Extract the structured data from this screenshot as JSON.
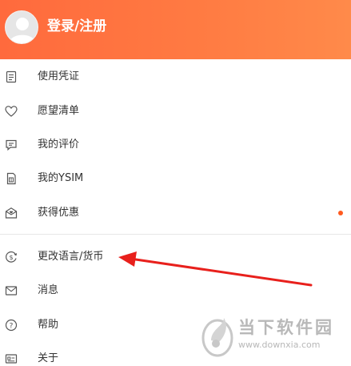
{
  "header": {
    "login_label": "登录/注册"
  },
  "menu": {
    "items": [
      {
        "label": "使用凭证",
        "icon": "voucher-icon"
      },
      {
        "label": "愿望清单",
        "icon": "heart-icon"
      },
      {
        "label": "我的评价",
        "icon": "comment-icon"
      },
      {
        "label": "我的YSIM",
        "icon": "sim-card-icon"
      },
      {
        "label": "获得优惠",
        "icon": "coupon-icon",
        "badge": "dot"
      },
      {
        "label": "更改语言/货币",
        "icon": "currency-icon"
      },
      {
        "label": "消息",
        "icon": "mail-icon"
      },
      {
        "label": "帮助",
        "icon": "help-icon"
      },
      {
        "label": "关于",
        "icon": "about-icon"
      }
    ]
  },
  "watermark": {
    "name": "当下软件园",
    "url": "www.downxia.com"
  },
  "colors": {
    "header_gradient_start": "#ff6a3d",
    "header_gradient_end": "#ff8a4a",
    "badge_dot": "#ff5a1f",
    "annotation_arrow": "#e8201c"
  }
}
